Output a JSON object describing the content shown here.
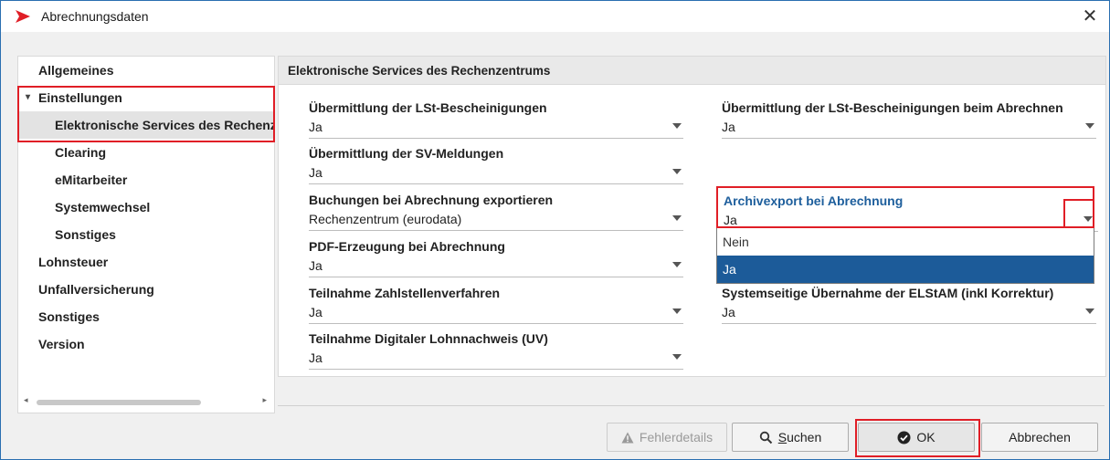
{
  "window": {
    "title": "Abrechnungsdaten",
    "close_glyph": "✕"
  },
  "nav": {
    "items": [
      {
        "label": "Allgemeines"
      },
      {
        "label": "Einstellungen",
        "caret": "▾"
      },
      {
        "label": "Elektronische Services des Rechenzentrums"
      },
      {
        "label": "Clearing"
      },
      {
        "label": "eMitarbeiter"
      },
      {
        "label": "Systemwechsel"
      },
      {
        "label": "Sonstiges"
      },
      {
        "label": "Lohnsteuer"
      },
      {
        "label": "Unfallversicherung"
      },
      {
        "label": "Sonstiges"
      },
      {
        "label": "Version"
      }
    ],
    "scroll_left": "◂",
    "scroll_right": "▸"
  },
  "content": {
    "title": "Elektronische Services des Rechenzentrums",
    "fields_left": [
      {
        "label": "Übermittlung der LSt-Bescheinigungen",
        "value": "Ja"
      },
      {
        "label": "Übermittlung der SV-Meldungen",
        "value": "Ja"
      },
      {
        "label": "Buchungen bei Abrechnung exportieren",
        "value": "Rechenzentrum (eurodata)"
      },
      {
        "label": "PDF-Erzeugung bei Abrechnung",
        "value": "Ja"
      },
      {
        "label": "Teilnahme Zahlstellenverfahren",
        "value": "Ja"
      },
      {
        "label": "Teilnahme Digitaler Lohnnachweis (UV)",
        "value": "Ja"
      }
    ],
    "fields_right": [
      {
        "label": "Übermittlung der LSt-Bescheinigungen beim Abrechnen",
        "value": "Ja"
      },
      {
        "label": "Archivexport bei Abrechnung",
        "value": "Ja"
      },
      {
        "label": "Systemseitige Übernahme der ELStAM (inkl Korrektur)",
        "value": "Ja"
      }
    ],
    "dropdown_options": [
      "Nein",
      "Ja"
    ],
    "dropdown_selected": "Ja"
  },
  "buttons": {
    "fehlerdetails": "Fehlerdetails",
    "suchen_underline": "S",
    "suchen_rest": "uchen",
    "ok": "OK",
    "abbrechen": "Abbrechen"
  },
  "colors": {
    "accent_red": "#e01e26",
    "selection_blue": "#1c5b99",
    "focused_label": "#1d5e9c"
  },
  "icons": [
    "app-logo-icon",
    "close-icon",
    "collapse-caret-icon",
    "chevron-down-icon",
    "warning-icon",
    "search-icon",
    "check-circle-icon"
  ]
}
